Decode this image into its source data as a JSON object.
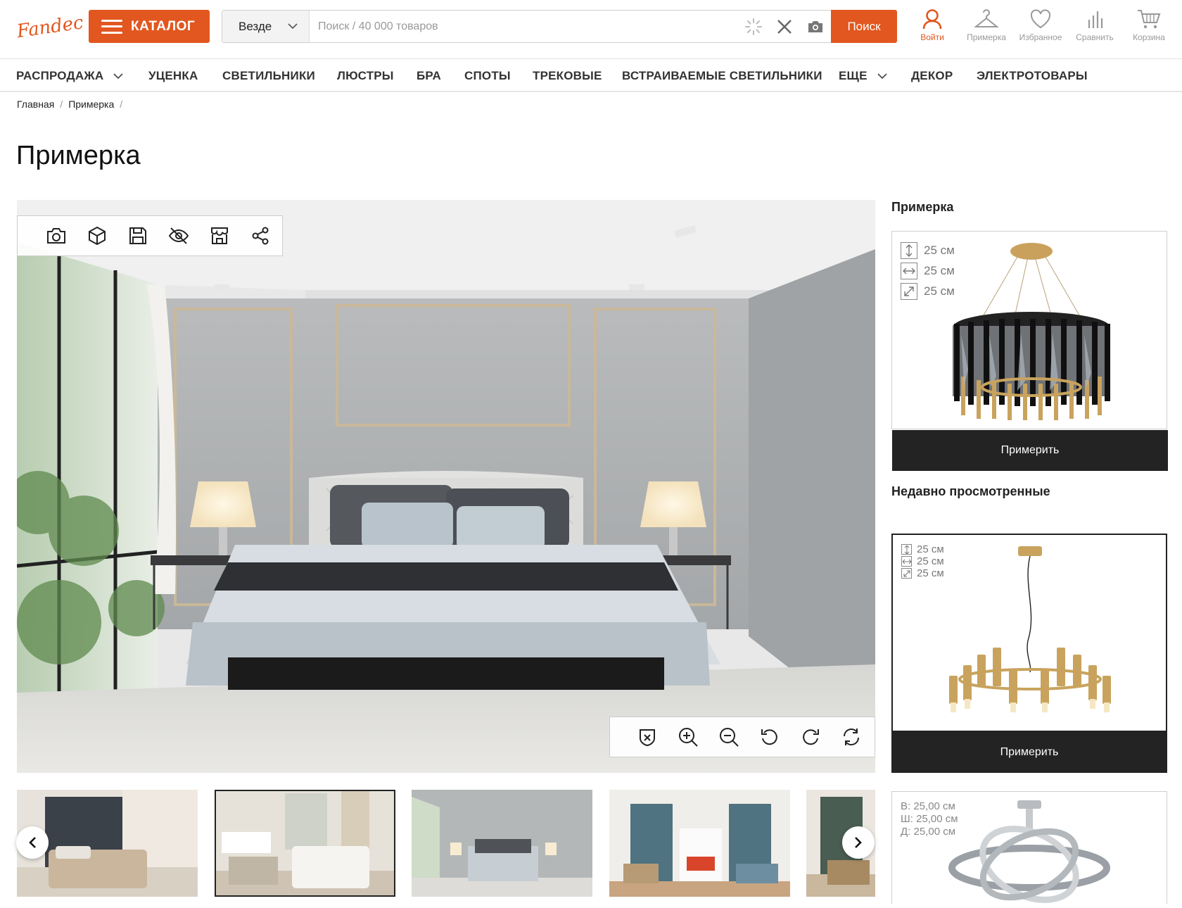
{
  "header": {
    "logo_text": "Fandeco",
    "catalog_label": "КАТАЛОГ",
    "search_scope": "Везде",
    "search_placeholder": "Поиск / 40 000 товаров",
    "search_button": "Поиск",
    "icons": [
      {
        "name": "login",
        "label": "Войти",
        "icon": "user-icon",
        "active": true
      },
      {
        "name": "fitting",
        "label": "Примерка",
        "icon": "hanger-icon",
        "active": false
      },
      {
        "name": "favorites",
        "label": "Избранное",
        "icon": "heart-icon",
        "active": false
      },
      {
        "name": "compare",
        "label": "Сравнить",
        "icon": "bars-icon",
        "active": false
      },
      {
        "name": "cart",
        "label": "Корзина",
        "icon": "cart-icon",
        "active": false
      }
    ]
  },
  "nav": {
    "items": [
      {
        "label": "РАСПРОДАЖА",
        "dropdown": true
      },
      {
        "label": "УЦЕНКА",
        "dropdown": false
      },
      {
        "label": "СВЕТИЛЬНИКИ",
        "dropdown": false
      },
      {
        "label": "ЛЮСТРЫ",
        "dropdown": false
      },
      {
        "label": "БРА",
        "dropdown": false
      },
      {
        "label": "СПОТЫ",
        "dropdown": false
      },
      {
        "label": "ТРЕКОВЫЕ",
        "dropdown": false
      },
      {
        "label": "ВСТРАИВАЕМЫЕ СВЕТИЛЬНИКИ",
        "dropdown": false
      },
      {
        "label": "ЕЩЕ",
        "dropdown": true
      },
      {
        "label": "ДЕКОР",
        "dropdown": false
      },
      {
        "label": "ЭЛЕКТРОТОВАРЫ",
        "dropdown": false
      }
    ]
  },
  "breadcrumbs": [
    "Главная",
    "Примерка"
  ],
  "page_title": "Примерка",
  "sidebar": {
    "fitting_title": "Примерка",
    "fitting_card": {
      "height": "25 см",
      "width": "25 см",
      "depth": "25 см",
      "button": "Примерить"
    },
    "recent_title": "Недавно просмотренные",
    "recent": [
      {
        "height": "25 см",
        "width": "25 см",
        "depth": "25 см",
        "button": "Примерить",
        "selected": true
      },
      {
        "height": "В: 25,00 см",
        "width": "Ш: 25,00 см",
        "depth": "Д: 25,00 см"
      }
    ]
  },
  "colors": {
    "accent": "#e2571f",
    "dark_button": "#232323"
  }
}
